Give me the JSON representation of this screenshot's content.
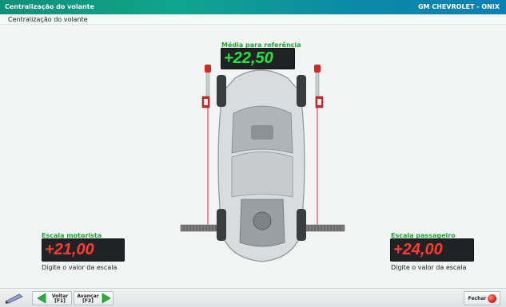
{
  "window": {
    "title": "Centralização do volante",
    "vehicle": "GM CHEVROLET - ONIX"
  },
  "breadcrumb": "Centralização do volante",
  "reference": {
    "label": "Média para referência",
    "value": "+22,50"
  },
  "driver_scale": {
    "label": "Escala motorista",
    "value": "+21,00",
    "hint": "Digite o valor da escala"
  },
  "passenger_scale": {
    "label": "Escala passageiro",
    "value": "+24,00",
    "hint": "Digite o valor da escala"
  },
  "nav": {
    "back_label": "Voltar",
    "back_key": "[F1]",
    "next_label": "Avançar",
    "next_key": "[F2]",
    "close_label": "Fechar"
  },
  "colors": {
    "title_bar": "#0fa58c",
    "label_green": "#18a82c",
    "display_green": "#22e63a",
    "display_red": "#ff3b30",
    "close_red": "#e0241b"
  },
  "icons": [
    "pencil-icon",
    "back-arrow-icon",
    "next-arrow-icon",
    "close-icon"
  ]
}
